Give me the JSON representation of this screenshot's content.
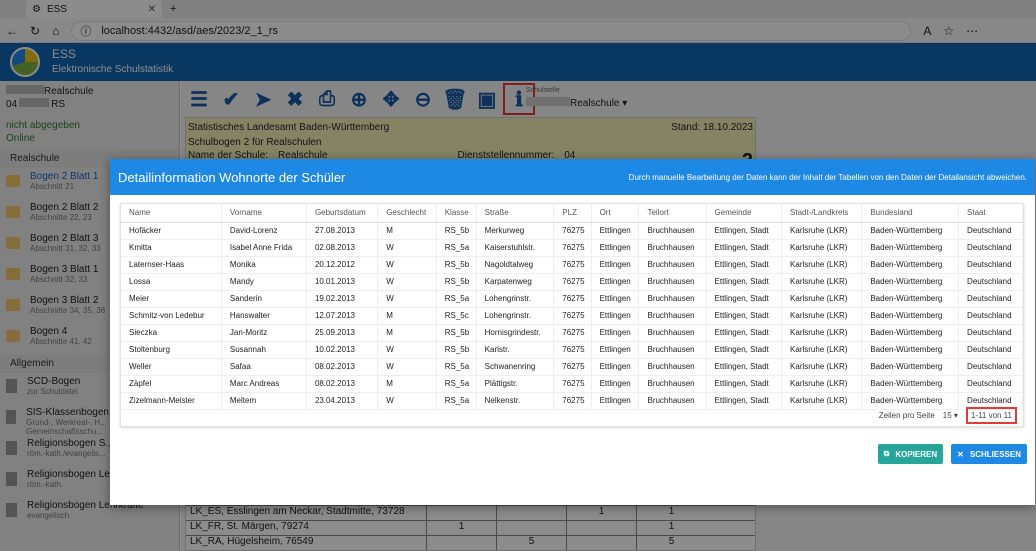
{
  "browser": {
    "tab_title": "ESS",
    "url": "localhost:4432/asd/aes/2023/2_1_rs"
  },
  "app": {
    "title": "ESS",
    "subtitle": "Elektronische Schulstatistik"
  },
  "sidebar": {
    "school_name": "Realschule",
    "school_num": "04",
    "school_num_suffix": "RS",
    "status1": "nicht abgegeben",
    "status2": "Online",
    "section1": "Realschule",
    "items": [
      {
        "title": "Bogen 2 Blatt 1",
        "sub": "Abschnitt 21"
      },
      {
        "title": "Bogen 2 Blatt 2",
        "sub": "Abschnitte 22, 23"
      },
      {
        "title": "Bogen 2 Blatt 3",
        "sub": "Abschnitt 31, 32, 33"
      },
      {
        "title": "Bogen 3 Blatt 1",
        "sub": "Abschnitt 32, 33"
      },
      {
        "title": "Bogen 3 Blatt 2",
        "sub": "Abschnitte 34, 35, 36"
      },
      {
        "title": "Bogen 4",
        "sub": "Abschnitte 41, 42"
      }
    ],
    "section2": "Allgemein",
    "items2": [
      {
        "title": "SCD-Bogen",
        "sub": "zur Schuldatei"
      },
      {
        "title": "SIS-Klassenbogen",
        "sub": "Grund-, Werkreal-, H... Gemeinschaftsschu..."
      },
      {
        "title": "Religionsbogen S...",
        "sub": "röm.-kath./evangelis..."
      },
      {
        "title": "Religionsbogen Le...",
        "sub": "röm.-kath."
      },
      {
        "title": "Religionsbogen Lehrkräfte",
        "sub": "evangelisch"
      }
    ]
  },
  "toolbar": {
    "schulstelle_label": "Schulstelle",
    "schulstelle_value": "Realschule"
  },
  "form": {
    "line1": "Statistisches Landesamt Baden-Württemberg",
    "stand": "Stand: 18.10.2023",
    "line2": "Schulbogen 2 für Realschulen",
    "name_label": "Name der Schule:",
    "name_value": "Realschule",
    "dienst_label": "Dienststellennummer:",
    "dienst_value": "04",
    "big_num": "2",
    "rows": [
      {
        "label": "LK_ES, Esslingen am Neckar, Stadtmitte, 73728",
        "a": "",
        "b": "",
        "c": "1",
        "d": "1"
      },
      {
        "label": "LK_FR, St. Märgen, 79274",
        "a": "1",
        "b": "",
        "c": "",
        "d": "1"
      },
      {
        "label": "LK_RA, Hügelsheim, 76549",
        "a": "",
        "b": "5",
        "c": "",
        "d": "5"
      }
    ]
  },
  "dialog": {
    "title": "Detailinformation Wohnorte der Schüler",
    "note": "Durch manuelle Bearbeitung der Daten kann der Inhalt der Tabellen von den Daten der Detailansicht abweichen.",
    "columns": [
      "Name",
      "Vorname",
      "Geburtsdatum",
      "Geschlecht",
      "Klasse",
      "Straße",
      "PLZ",
      "Ort",
      "Teilort",
      "Gemeinde",
      "Stadt-/Landkreis",
      "Bundesland",
      "Staat"
    ],
    "rows": [
      [
        "Hofäcker",
        "David-Lorenz",
        "27.08.2013",
        "M",
        "RS_5b",
        "Merkurweg",
        "76275",
        "Ettlingen",
        "Bruchhausen",
        "Ettlingen, Stadt",
        "Karlsruhe (LKR)",
        "Baden-Württemberg",
        "Deutschland"
      ],
      [
        "Kmitta",
        "Isabel Anne Frida",
        "02.08.2013",
        "W",
        "RS_5a",
        "Kaiserstuhlstr.",
        "76275",
        "Ettlingen",
        "Bruchhausen",
        "Ettlingen, Stadt",
        "Karlsruhe (LKR)",
        "Baden-Württemberg",
        "Deutschland"
      ],
      [
        "Laternser-Haas",
        "Monika",
        "20.12.2012",
        "W",
        "RS_5b",
        "Nagoldtalweg",
        "76275",
        "Ettlingen",
        "Bruchhausen",
        "Ettlingen, Stadt",
        "Karlsruhe (LKR)",
        "Baden-Württemberg",
        "Deutschland"
      ],
      [
        "Lossa",
        "Mandy",
        "10.01.2013",
        "W",
        "RS_5b",
        "Karpatenweg",
        "76275",
        "Ettlingen",
        "Bruchhausen",
        "Ettlingen, Stadt",
        "Karlsruhe (LKR)",
        "Baden-Württemberg",
        "Deutschland"
      ],
      [
        "Meier",
        "Sanderin",
        "19.02.2013",
        "W",
        "RS_5a",
        "Lohengrinstr.",
        "76275",
        "Ettlingen",
        "Bruchhausen",
        "Ettlingen, Stadt",
        "Karlsruhe (LKR)",
        "Baden-Württemberg",
        "Deutschland"
      ],
      [
        "Schmitz-von Ledebur",
        "Hanswalter",
        "12.07.2013",
        "M",
        "RS_5c",
        "Lohengrinstr.",
        "76275",
        "Ettlingen",
        "Bruchhausen",
        "Ettlingen, Stadt",
        "Karlsruhe (LKR)",
        "Baden-Württemberg",
        "Deutschland"
      ],
      [
        "Sieczka",
        "Jan-Moritz",
        "25.09.2013",
        "M",
        "RS_5b",
        "Hornisgrindestr.",
        "76275",
        "Ettlingen",
        "Bruchhausen",
        "Ettlingen, Stadt",
        "Karlsruhe (LKR)",
        "Baden-Württemberg",
        "Deutschland"
      ],
      [
        "Stoltenburg",
        "Susannah",
        "10.02.2013",
        "W",
        "RS_5b",
        "Karlstr.",
        "76275",
        "Ettlingen",
        "Bruchhausen",
        "Ettlingen, Stadt",
        "Karlsruhe (LKR)",
        "Baden-Württemberg",
        "Deutschland"
      ],
      [
        "Weller",
        "Safaa",
        "08.02.2013",
        "W",
        "RS_5a",
        "Schwanenring",
        "76275",
        "Ettlingen",
        "Bruchhausen",
        "Ettlingen, Stadt",
        "Karlsruhe (LKR)",
        "Baden-Württemberg",
        "Deutschland"
      ],
      [
        "Zäpfel",
        "Marc Andreas",
        "08.02.2013",
        "M",
        "RS_5a",
        "Plättigstr.",
        "76275",
        "Ettlingen",
        "Bruchhausen",
        "Ettlingen, Stadt",
        "Karlsruhe (LKR)",
        "Baden-Württemberg",
        "Deutschland"
      ],
      [
        "Zizelmann-Meister",
        "Meltem",
        "23.04.2013",
        "W",
        "RS_5a",
        "Nelkenstr.",
        "76275",
        "Ettlingen",
        "Bruchhausen",
        "Ettlingen, Stadt",
        "Karlsruhe (LKR)",
        "Baden-Württemberg",
        "Deutschland"
      ]
    ],
    "rows_per_page_label": "Zeilen pro Seite",
    "rows_per_page": "15",
    "range": "1-11 von 11",
    "copy_label": "KOPIEREN",
    "close_label": "SCHLIESSEN"
  },
  "colors": {
    "header": "#0f67b1",
    "dialog_header": "#1e88e5",
    "copy": "#26a69a",
    "highlight": "#e53935"
  }
}
